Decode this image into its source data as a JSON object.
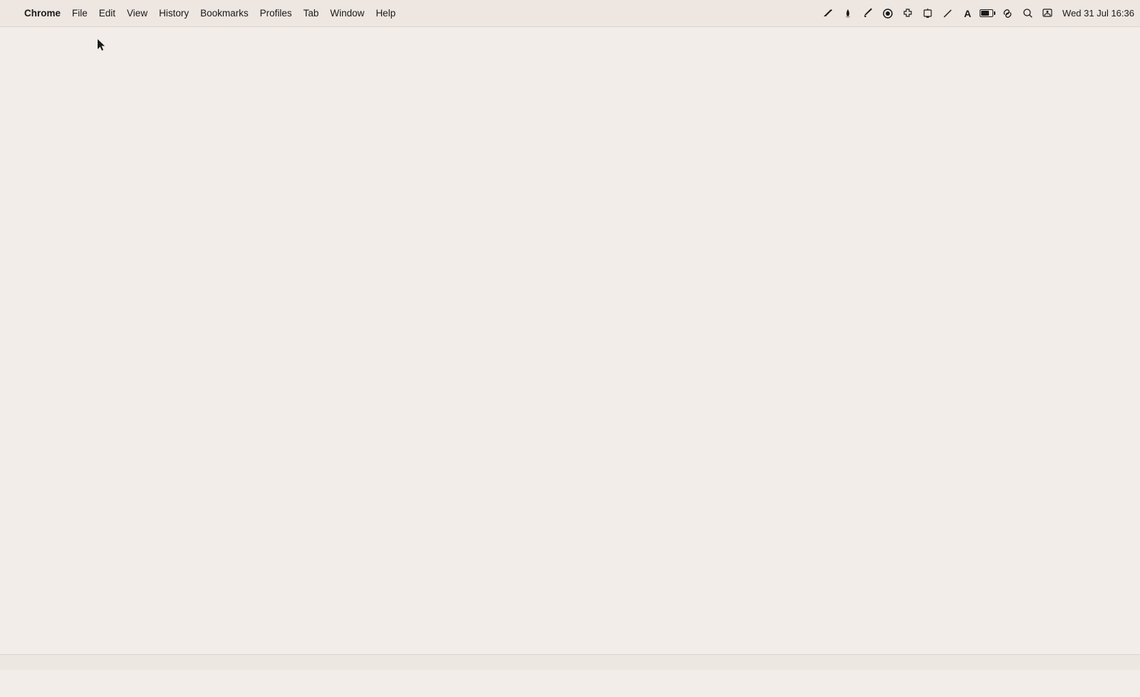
{
  "menubar": {
    "apple_label": "",
    "menus": [
      {
        "id": "chrome",
        "label": "Chrome",
        "bold": true
      },
      {
        "id": "file",
        "label": "File",
        "bold": false
      },
      {
        "id": "edit",
        "label": "Edit",
        "bold": false
      },
      {
        "id": "view",
        "label": "View",
        "bold": false
      },
      {
        "id": "history",
        "label": "History",
        "bold": false
      },
      {
        "id": "bookmarks",
        "label": "Bookmarks",
        "bold": false
      },
      {
        "id": "profiles",
        "label": "Profiles",
        "bold": false
      },
      {
        "id": "tab",
        "label": "Tab",
        "bold": false
      },
      {
        "id": "window",
        "label": "Window",
        "bold": false
      },
      {
        "id": "help",
        "label": "Help",
        "bold": false
      }
    ],
    "datetime": "Wed 31 Jul  16:36"
  },
  "background_color": "#f2ede8"
}
